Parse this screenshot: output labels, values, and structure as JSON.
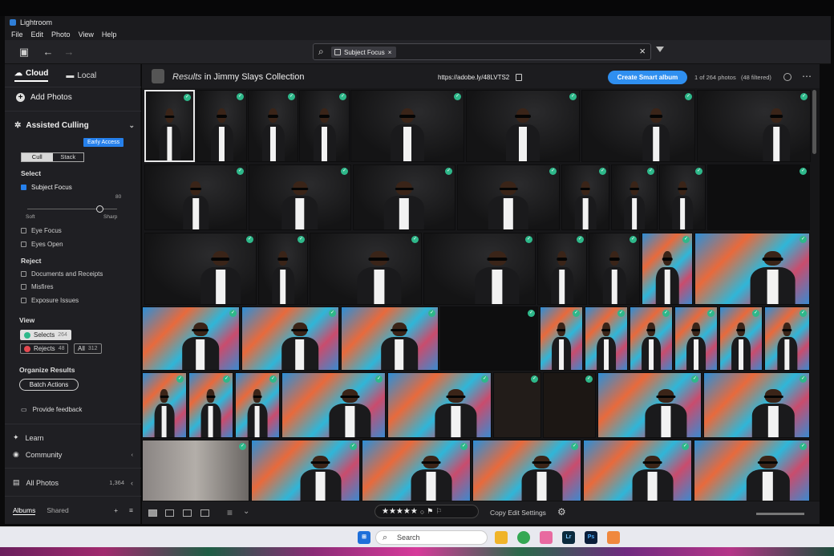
{
  "app": {
    "title": "Lightroom"
  },
  "menu": [
    "File",
    "Edit",
    "Photo",
    "View",
    "Help"
  ],
  "search": {
    "chip_label": "Subject Focus",
    "clear": "×"
  },
  "sidebar": {
    "tabs": [
      {
        "label": "Cloud"
      },
      {
        "label": "Local"
      }
    ],
    "add_photos": "Add Photos",
    "culling": {
      "title": "Assisted Culling",
      "badge": "Early Access",
      "mode_cull": "Cull",
      "mode_stack": "Stack"
    },
    "select": {
      "heading": "Select",
      "subject_focus": "Subject Focus",
      "slider_value": "80",
      "slider_min": "Soft",
      "slider_max": "Sharp",
      "eye_focus": "Eye Focus",
      "eyes_open": "Eyes Open"
    },
    "reject": {
      "heading": "Reject",
      "items": [
        "Documents and Receipts",
        "Misfires",
        "Exposure Issues"
      ]
    },
    "view": {
      "heading": "View",
      "selects_label": "Selects",
      "selects_count": "264",
      "rejects_label": "Rejects",
      "rejects_count": "48",
      "all_label": "All",
      "all_count": "312"
    },
    "organize": {
      "heading": "Organize Results",
      "batch": "Batch Actions"
    },
    "feedback": "Provide feedback",
    "learn": "Learn",
    "community": "Community",
    "all_photos": "All Photos",
    "all_photos_count": "1,364",
    "albums_tab": "Albums",
    "shared_tab": "Shared"
  },
  "header": {
    "prefix": "Results",
    "mid": " in ",
    "collection": "Jimmy Slays Collection",
    "url": "https://adobe.ly/48LVTS2",
    "smart_button": "Create Smart album",
    "count": "1 of 264 photos",
    "filtered": "(48 filtered)"
  },
  "bottom": {
    "copy_edit": "Copy Edit Settings",
    "stars": "★★★★★"
  },
  "taskbar": {
    "search": "Search",
    "lr": "Lr",
    "ps": "Ps"
  }
}
